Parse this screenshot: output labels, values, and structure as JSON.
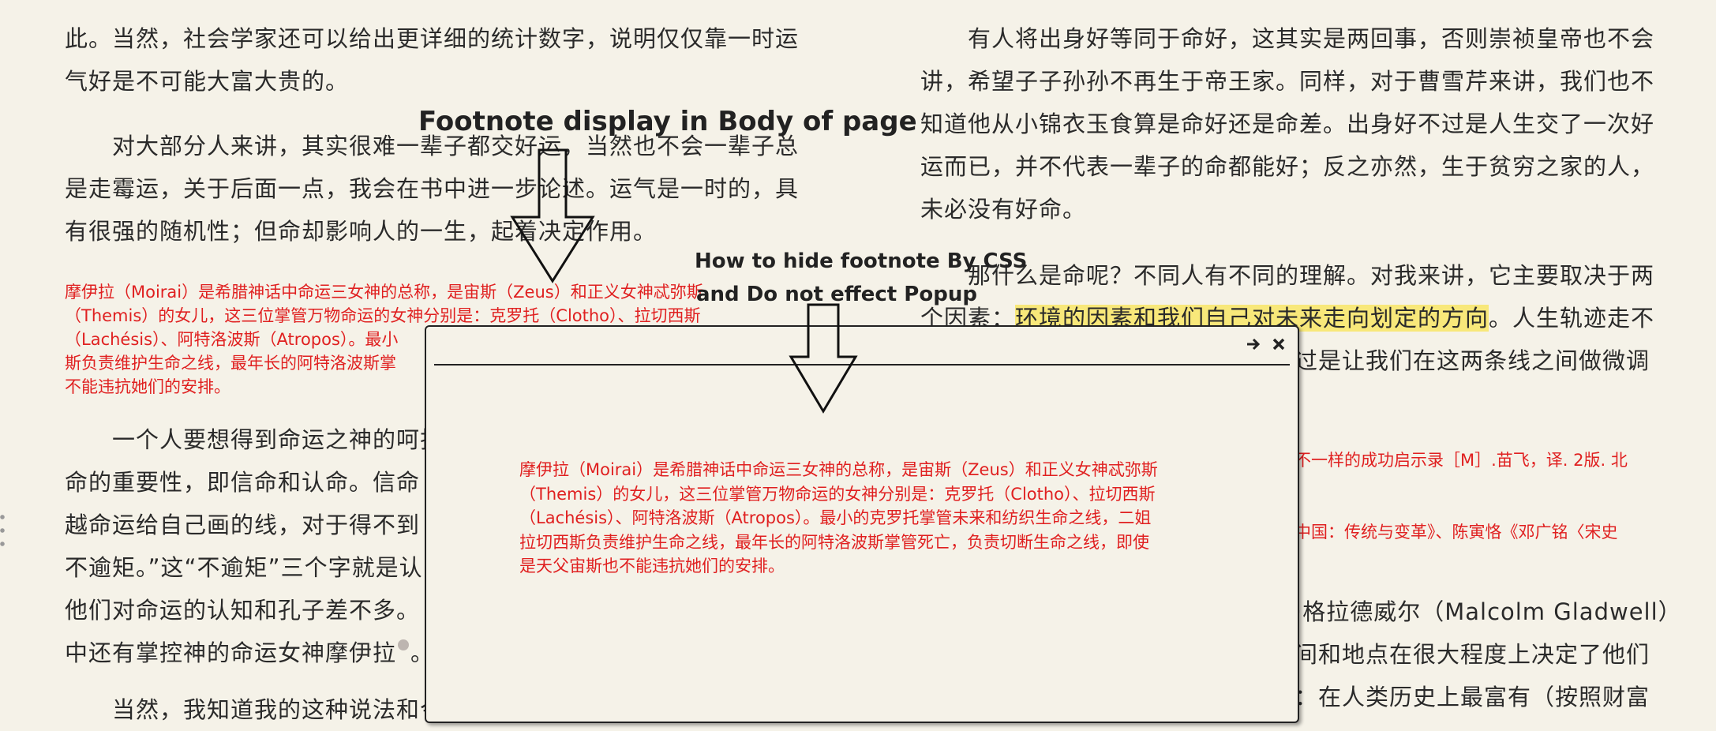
{
  "left_column": {
    "para1": [
      "此。当然，社会学家还可以给出更详细的统计数字，说明仅仅靠一时运",
      "气好是不可能大富大贵的。"
    ],
    "para2": [
      "　　对大部分人来讲，其实很难一辈子都交好运，当然也不会一辈子总",
      "是走霉运，关于后面一点，我会在书中进一步论述。运气是一时的，具",
      "有很强的随机性；但命却影响人的一生，起着决定作用。"
    ],
    "footnote": [
      "摩伊拉（Moirai）是希腊神话中命运三女神的总称，是宙斯（Zeus）和正义女神忒弥斯",
      "（Themis）的女儿，这三位掌管万物命运的女神分别是：克罗托（Clotho）、拉切西斯",
      "（Lachésis）、阿特洛波斯（Atropos）。最小",
      "斯负责维护生命之线，最年长的阿特洛波斯掌",
      "不能违抗她们的安排。"
    ],
    "para3": [
      "　　一个人要想得到命运之神的呵护",
      "命的重要性，即信命和认命。信命",
      "越命运给自己画的线，对于得不到",
      "不逾矩。”这“不逾矩”三个字就是认",
      "他们对命运的认知和孔子差不多。",
      "中还有掌控神的命运女神摩伊拉",
      "　　当然，我知道我的这种说法和今天很多人认为的要靠自己不一样"
    ],
    "para3_tail": "。"
  },
  "right_column": {
    "para1": [
      "　　有人将出身好等同于命好，这其实是两回事，否则崇祯皇帝也不会",
      "讲，希望子子孙孙不再生于帝王家。同样，对于曹雪芹来讲，我们也不",
      "知道他从小锦衣玉食算是命好还是命差。出身好不过是人生交了一次好",
      "运而已，并不代表一辈子的命都能好；反之亦然，生于贫穷之家的人，",
      "未必没有好命。"
    ],
    "para2_line1": "　　那什么是命呢？不同人有不同的理解。对我来讲，它主要取决于两",
    "para2_line2_prefix": "个因素：",
    "para2_highlight": "环境的因素和我们自己对未来走向划定的方向",
    "para2_line2_suffix": "。人生轨迹走不",
    "para2_line3": "过是让我们在这两条线之间做微调",
    "fn1": "不一样的成功启示录［M］.苗飞，译. 2版. 北",
    "fn2": "中国：传统与变革》、陈寅恪《邓广铭〈宋史",
    "para3": [
      "·格拉德威尔（Malcolm Gladwell）",
      "间和地点在很大程度上决定了他们",
      "：在人类历史上最富有（按照财富"
    ]
  },
  "annotations": {
    "title": "Footnote display in Body of page",
    "css_note_line1": "How to hide footnote By CSS",
    "css_note_line2": "and Do not effect Popup"
  },
  "popup": {
    "lines": [
      "摩伊拉（Moirai）是希腊神话中命运三女神的总称，是宙斯（Zeus）和正义女神忒弥斯",
      "（Themis）的女儿，这三位掌管万物命运的女神分别是：克罗托（Clotho）、拉切西斯",
      "（Lachésis）、阿特洛波斯（Atropos）。最小的克罗托掌管未来和纺织生命之线，二姐",
      "拉切西斯负责维护生命之线，最年长的阿特洛波斯掌管死亡，负责切断生命之线，即使",
      "是天父宙斯也不能违抗她们的安排。"
    ],
    "go_icon": "arrow-right-icon",
    "close_icon": "close-icon"
  },
  "colors": {
    "background": "#f5f2e8",
    "footnote_red": "#e02020",
    "highlight": "#f8e87a"
  }
}
